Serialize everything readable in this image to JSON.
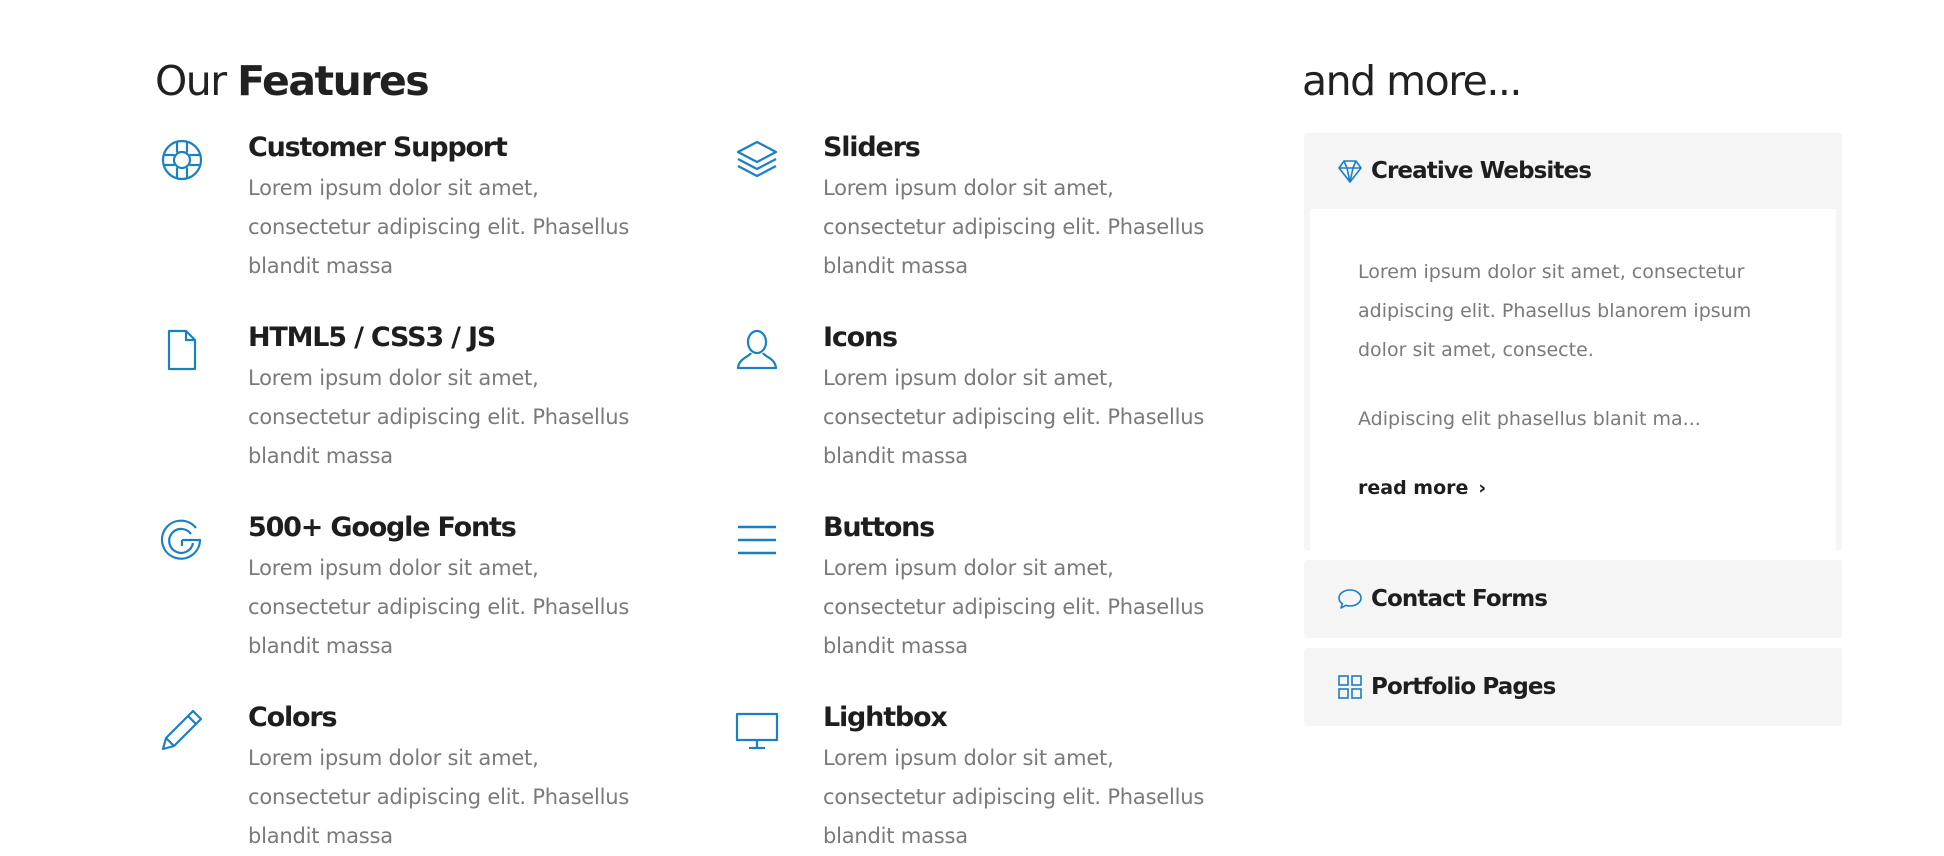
{
  "features_heading": {
    "light": "Our",
    "bold": "Features"
  },
  "more_heading": "and more...",
  "features": [
    {
      "icon": "lifebuoy-icon",
      "title": "Customer Support",
      "text": "Lorem ipsum dolor sit amet, consectetur adipiscing elit. Phasellus blandit massa"
    },
    {
      "icon": "layers-icon",
      "title": "Sliders",
      "text": "Lorem ipsum dolor sit amet, consectetur adipiscing elit. Phasellus blandit massa"
    },
    {
      "icon": "file-icon",
      "title": "HTML5 / CSS3 / JS",
      "text": "Lorem ipsum dolor sit amet, consectetur adipiscing elit. Phasellus blandit massa"
    },
    {
      "icon": "user-icon",
      "title": "Icons",
      "text": "Lorem ipsum dolor sit amet, consectetur adipiscing elit. Phasellus blandit massa"
    },
    {
      "icon": "google-icon",
      "title": "500+ Google Fonts",
      "text": "Lorem ipsum dolor sit amet, consectetur adipiscing elit. Phasellus blandit massa"
    },
    {
      "icon": "menu-icon",
      "title": "Buttons",
      "text": "Lorem ipsum dolor sit amet, consectetur adipiscing elit. Phasellus blandit massa"
    },
    {
      "icon": "pencil-icon",
      "title": "Colors",
      "text": "Lorem ipsum dolor sit amet, consectetur adipiscing elit. Phasellus blandit massa"
    },
    {
      "icon": "monitor-icon",
      "title": "Lightbox",
      "text": "Lorem ipsum dolor sit amet, consectetur adipiscing elit. Phasellus blandit massa"
    }
  ],
  "accordion": [
    {
      "icon": "diamond-icon",
      "title": "Creative Websites",
      "expanded": true,
      "paragraph1": "Lorem ipsum dolor sit amet, consectetur adipiscing elit. Phasellus blanorem ipsum dolor sit amet, consecte.",
      "paragraph2": "Adipiscing elit phasellus blanit ma...",
      "read_more": "read more"
    },
    {
      "icon": "speech-bubble-icon",
      "title": "Contact Forms",
      "expanded": false
    },
    {
      "icon": "grid-icon",
      "title": "Portfolio Pages",
      "expanded": false
    }
  ],
  "colors": {
    "accent": "#1b7fc4",
    "heading": "#1e1e1e",
    "body_text": "#7a7a7a",
    "panel_bg": "#f5f5f5"
  }
}
